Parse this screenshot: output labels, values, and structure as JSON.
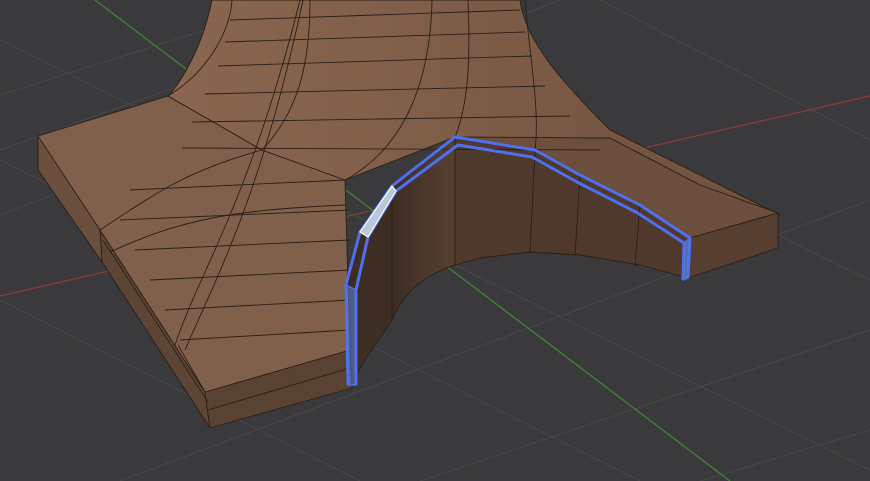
{
  "viewport": {
    "mode": "edit-mode",
    "selection": "loop-faces",
    "colors": {
      "background": "#3a3a3c",
      "grid_line": "#48484b",
      "x_axis": "#8f3a3a",
      "y_axis": "#3f8a34",
      "mesh_base": "#7a5a45",
      "mesh_light": "#8b6650",
      "mesh_dark": "#4e3a2e",
      "edge_wire": "#2a1e16",
      "selection": "#4f6ff0",
      "selection_fill": "#5a82d8",
      "active_face": "#b8c8d8"
    }
  }
}
